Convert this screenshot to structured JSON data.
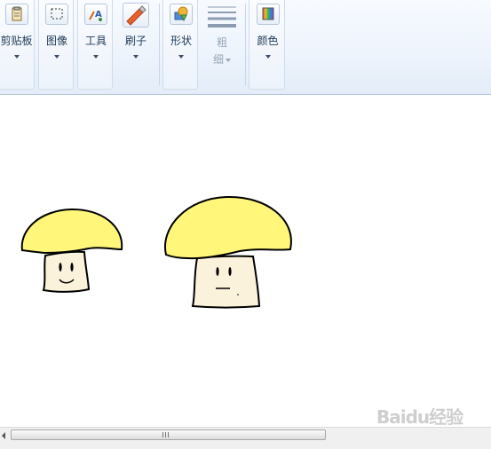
{
  "ribbon": {
    "tools": [
      {
        "key": "clipboard",
        "label": "剪贴板",
        "icon": "clipboard-icon"
      },
      {
        "key": "image",
        "label": "图像",
        "icon": "select-icon"
      },
      {
        "key": "tools",
        "label": "工具",
        "icon": "tools-icon"
      },
      {
        "key": "brushes",
        "label": "刷子",
        "icon": "brush-icon"
      },
      {
        "key": "shapes",
        "label": "形状",
        "icon": "shapes-icon"
      },
      {
        "key": "size",
        "label_line1": "粗",
        "label_line2": "细",
        "icon": "line-size-icon",
        "disabled": true
      },
      {
        "key": "colors",
        "label": "颜色",
        "icon": "colors-icon"
      }
    ]
  },
  "canvas": {
    "drawing": "two-mushrooms",
    "cap_color": "#fff67a",
    "stem_color": "#fbf2dc",
    "outline_color": "#000000"
  },
  "watermark": {
    "text": "Baidu经验"
  },
  "scrollbar": {
    "thumb_icon": "grip-icon"
  }
}
